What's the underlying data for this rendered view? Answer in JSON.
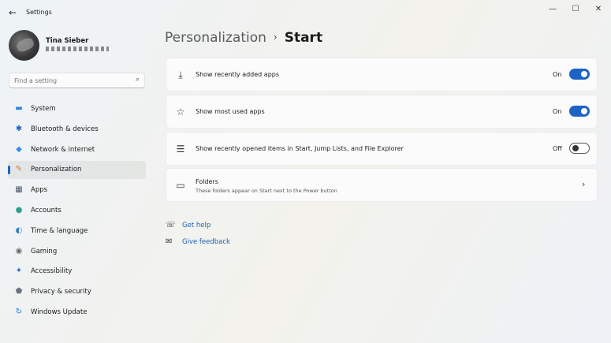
{
  "window": {
    "title": "Settings",
    "back_glyph": "←",
    "minimize_glyph": "—",
    "maximize_glyph": "☐",
    "close_glyph": "✕"
  },
  "profile": {
    "name": "Tina Sieber"
  },
  "search": {
    "placeholder": "Find a setting",
    "icon": "search-icon",
    "glyph": "⌕"
  },
  "sidebar": {
    "items": [
      {
        "label": "System",
        "icon": "display-icon",
        "glyph": "▬",
        "color": "#2b88d8",
        "active": false
      },
      {
        "label": "Bluetooth & devices",
        "icon": "bluetooth-icon",
        "glyph": "✱",
        "color": "#1d63c4",
        "active": false
      },
      {
        "label": "Network & internet",
        "icon": "wifi-icon",
        "glyph": "◆",
        "color": "#3a8ee6",
        "active": false
      },
      {
        "label": "Personalization",
        "icon": "brush-icon",
        "glyph": "✎",
        "color": "#d0792b",
        "active": true
      },
      {
        "label": "Apps",
        "icon": "apps-icon",
        "glyph": "▦",
        "color": "#4a5a6a",
        "active": false
      },
      {
        "label": "Accounts",
        "icon": "person-icon",
        "glyph": "●",
        "color": "#2f9e8f",
        "active": false
      },
      {
        "label": "Time & language",
        "icon": "globe-clock-icon",
        "glyph": "◐",
        "color": "#2f7dc8",
        "active": false
      },
      {
        "label": "Gaming",
        "icon": "gamepad-icon",
        "glyph": "◉",
        "color": "#6a6a6a",
        "active": false
      },
      {
        "label": "Accessibility",
        "icon": "accessibility-icon",
        "glyph": "✦",
        "color": "#2a6fc2",
        "active": false
      },
      {
        "label": "Privacy & security",
        "icon": "shield-icon",
        "glyph": "⬟",
        "color": "#6a7480",
        "active": false
      },
      {
        "label": "Windows Update",
        "icon": "update-icon",
        "glyph": "↻",
        "color": "#1d7ad8",
        "active": false
      }
    ]
  },
  "breadcrumb": {
    "parent": "Personalization",
    "separator": "›",
    "current": "Start"
  },
  "settings": [
    {
      "label": "Show recently added apps",
      "icon": "download-icon",
      "glyph": "⤓",
      "state": "On",
      "on": true
    },
    {
      "label": "Show most used apps",
      "icon": "star-icon",
      "glyph": "☆",
      "state": "On",
      "on": true
    },
    {
      "label": "Show recently opened items in Start, Jump Lists, and File Explorer",
      "icon": "list-icon",
      "glyph": "☰",
      "state": "Off",
      "on": false
    }
  ],
  "folders": {
    "title": "Folders",
    "description": "These folders appear on Start next to the Power button",
    "icon": "folder-icon",
    "glyph": "▭",
    "chevron": "›"
  },
  "links": [
    {
      "label": "Get help",
      "icon": "help-icon",
      "glyph": "☏"
    },
    {
      "label": "Give feedback",
      "icon": "feedback-icon",
      "glyph": "✉"
    }
  ],
  "colors": {
    "accent": "#1d63c4",
    "link": "#1d5fb4"
  }
}
